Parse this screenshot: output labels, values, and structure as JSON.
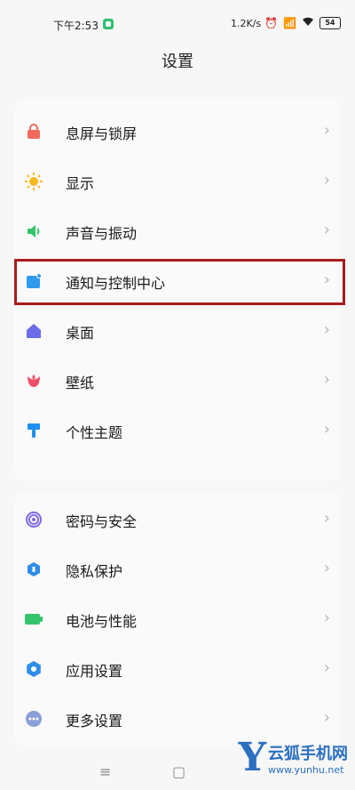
{
  "status_bar": {
    "time": "下午2:53",
    "network_speed": "1.2K/s",
    "battery": "54",
    "icons": [
      "alarm-icon",
      "signal-icon",
      "wifi-icon",
      "battery-icon"
    ]
  },
  "page": {
    "title": "设置"
  },
  "group1": [
    {
      "label": "息屏与锁屏",
      "icon": "lock-icon",
      "color": "#f06a5e"
    },
    {
      "label": "显示",
      "icon": "sun-icon",
      "color": "#f5b91f"
    },
    {
      "label": "声音与振动",
      "icon": "speaker-icon",
      "color": "#35c46a"
    },
    {
      "label": "通知与控制中心",
      "icon": "notification-icon",
      "color": "#2d9af0"
    },
    {
      "label": "桌面",
      "icon": "home-icon",
      "color": "#6b6ce8"
    },
    {
      "label": "壁纸",
      "icon": "tulip-icon",
      "color": "#ef4f6b"
    },
    {
      "label": "个性主题",
      "icon": "brush-icon",
      "color": "#1f8ff0"
    }
  ],
  "group2": [
    {
      "label": "密码与安全",
      "icon": "fingerprint-icon",
      "color": "#7d6ae8"
    },
    {
      "label": "隐私保护",
      "icon": "shield-icon",
      "color": "#2d8de8"
    },
    {
      "label": "电池与性能",
      "icon": "battery-icon",
      "color": "#35c46a"
    },
    {
      "label": "应用设置",
      "icon": "gear-icon",
      "color": "#2d8de8"
    },
    {
      "label": "更多设置",
      "icon": "more-icon",
      "color": "#8a9fd8"
    }
  ],
  "watermark": {
    "letter": "Y",
    "name": "云狐手机网",
    "url": "www.yunhu.net"
  }
}
